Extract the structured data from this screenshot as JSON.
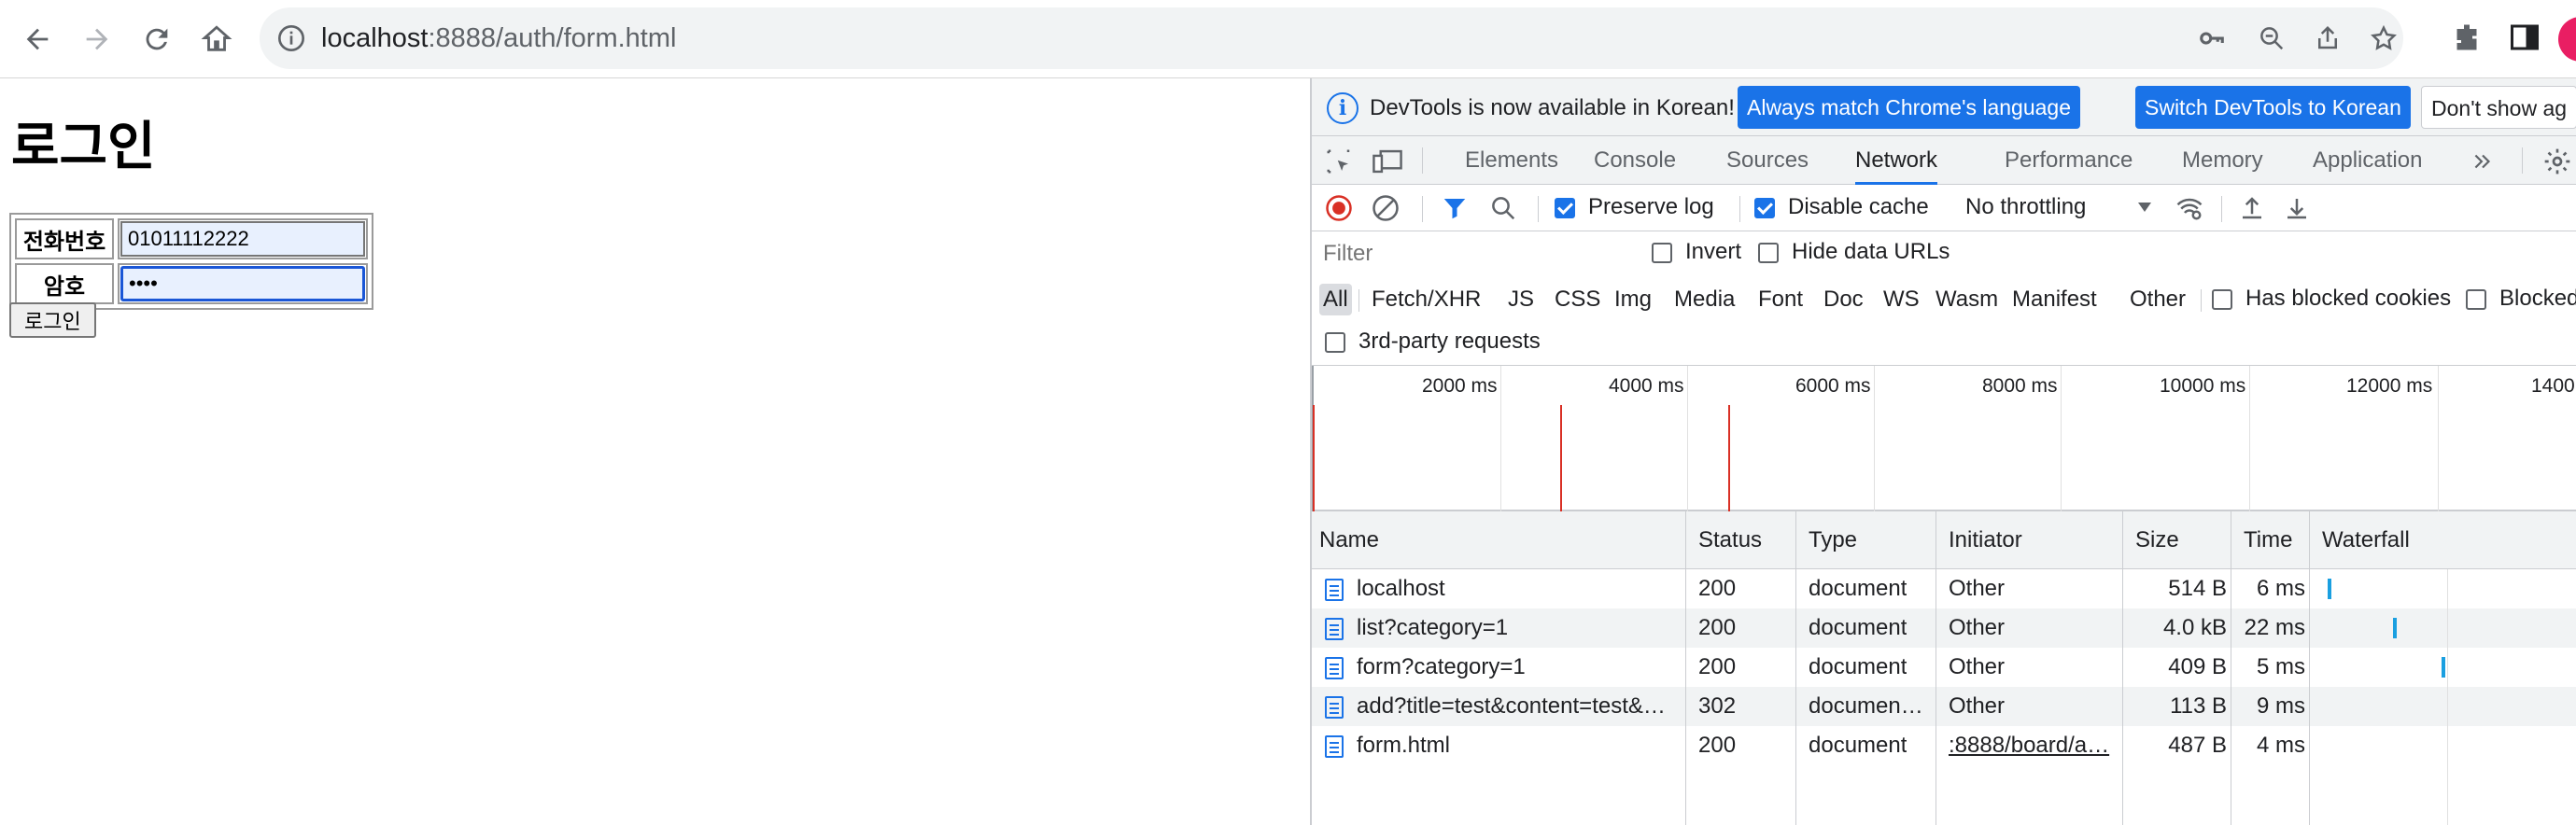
{
  "browser": {
    "url_host": "localhost",
    "url_path": ":8888/auth/form.html"
  },
  "page": {
    "title": "로그인",
    "phone_label": "전화번호",
    "phone_value": "01011112222",
    "password_label": "암호",
    "password_value": "••••",
    "submit_label": "로그인"
  },
  "devtools": {
    "infobar": {
      "message": "DevTools is now available in Korean!",
      "btn_match": "Always match Chrome's language",
      "btn_switch": "Switch DevTools to Korean",
      "btn_dont_show": "Don't show ag"
    },
    "tabs": [
      "Elements",
      "Console",
      "Sources",
      "Network",
      "Performance",
      "Memory",
      "Application"
    ],
    "active_tab": "Network",
    "toolbar": {
      "preserve_log": "Preserve log",
      "disable_cache": "Disable cache",
      "throttling": "No throttling"
    },
    "filter": {
      "placeholder": "Filter",
      "invert": "Invert",
      "hide_data_urls": "Hide data URLs"
    },
    "types": [
      "All",
      "Fetch/XHR",
      "JS",
      "CSS",
      "Img",
      "Media",
      "Font",
      "Doc",
      "WS",
      "Wasm",
      "Manifest",
      "Other"
    ],
    "has_blocked_cookies": "Has blocked cookies",
    "blocked": "Blocked",
    "third_party": "3rd-party requests",
    "timeline_ticks": [
      "2000 ms",
      "4000 ms",
      "6000 ms",
      "8000 ms",
      "10000 ms",
      "12000 ms",
      "1400"
    ],
    "columns": {
      "name": "Name",
      "status": "Status",
      "type": "Type",
      "initiator": "Initiator",
      "size": "Size",
      "time": "Time",
      "waterfall": "Waterfall"
    },
    "requests": [
      {
        "name": "localhost",
        "status": "200",
        "type": "document",
        "initiator": "Other",
        "size": "514 B",
        "time": "6 ms"
      },
      {
        "name": "list?category=1",
        "status": "200",
        "type": "document",
        "initiator": "Other",
        "size": "4.0 kB",
        "time": "22 ms"
      },
      {
        "name": "form?category=1",
        "status": "200",
        "type": "document",
        "initiator": "Other",
        "size": "409 B",
        "time": "5 ms"
      },
      {
        "name": "add?title=test&content=test&…",
        "status": "302",
        "type": "documen…",
        "initiator": "Other",
        "size": "113 B",
        "time": "9 ms"
      },
      {
        "name": "form.html",
        "status": "200",
        "type": "document",
        "initiator": ":8888/board/a…",
        "size": "487 B",
        "time": "4 ms"
      }
    ]
  }
}
